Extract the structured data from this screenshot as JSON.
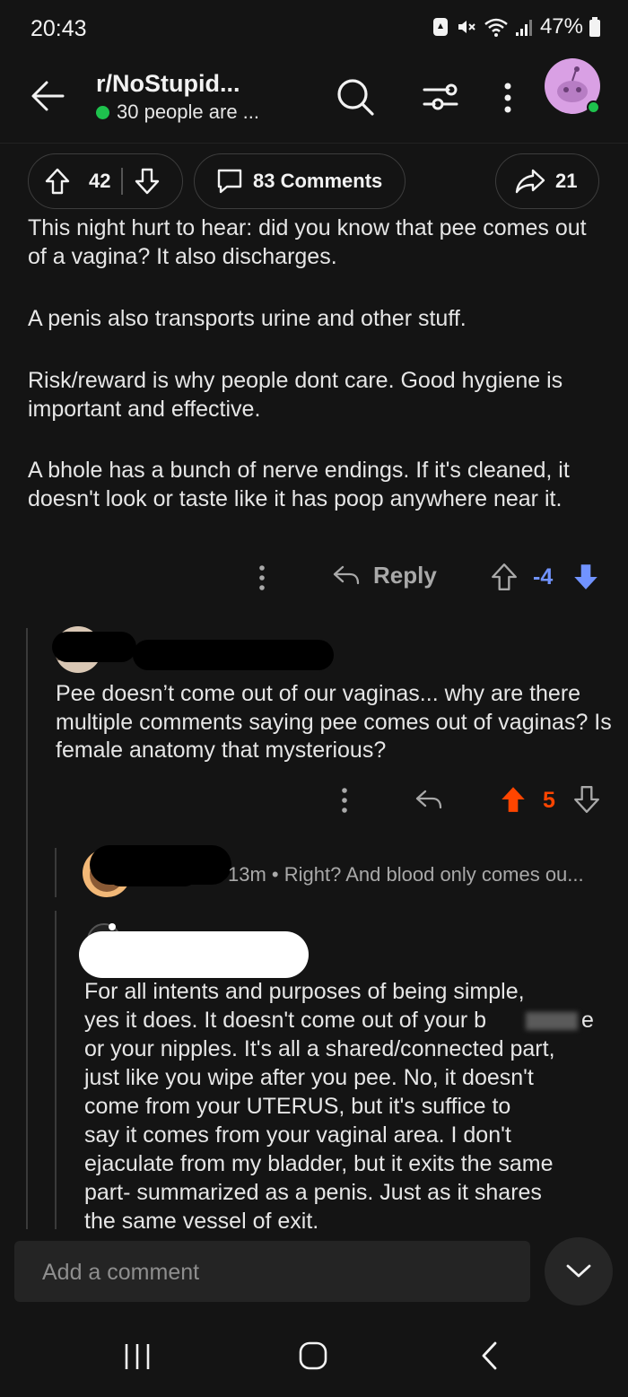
{
  "status_bar": {
    "time": "20:43",
    "battery": "47%"
  },
  "header": {
    "subreddit": "r/NoStupid...",
    "online": "30 people are ..."
  },
  "post_actions": {
    "upvotes": "42",
    "comments": "83 Comments",
    "shares": "21"
  },
  "parent_comment": {
    "paragraphs": [
      "This night hurt to hear: did you know that pee comes out of a vagina? It also discharges.",
      "A penis also transports urine and other stuff.",
      "Risk/reward is why people dont care. Good hygiene is important and effective.",
      "A bhole has a bunch of nerve endings. If it's cleaned, it doesn't look or taste like it has poop anywhere near it."
    ],
    "reply_label": "Reply",
    "score": "-4"
  },
  "reply_comment": {
    "text": "Pee doesn’t come out of our vaginas... why are there multiple comments saying pee comes out of vaginas? Is female anatomy that mysterious?",
    "score": "5"
  },
  "collapsed_comment": {
    "age": "13m",
    "separator": "•",
    "preview": "Right? And blood only comes ou..."
  },
  "nested_comment": {
    "lines": [
      "For all intents and purposes of being simple,",
      "yes it does. It doesn't come out of your b",
      "e",
      "or your nipples. It's all a shared/connected part,",
      "just like you wipe after you pee. No, it doesn't",
      "come from your UTERUS, but it's suffice to",
      "say it comes from your vaginal area. I don't",
      "ejaculate from my bladder, but it exits the same",
      "part- summarized as a penis. Just as it shares",
      "the same vessel of exit."
    ]
  },
  "composer": {
    "placeholder": "Add a comment"
  },
  "colors": {
    "background": "#141414",
    "online": "#1ec24d",
    "downvote": "#7193ff",
    "upvote": "#ff4500",
    "avatar": "#d9a0e4"
  },
  "icons": [
    "back-arrow-icon",
    "search-icon",
    "filter-icon",
    "more-vertical-icon",
    "avatar",
    "upvote-icon",
    "downvote-icon",
    "comment-icon",
    "share-icon",
    "reply-icon",
    "chevron-down-icon",
    "recents-icon",
    "home-icon",
    "back-nav-icon"
  ]
}
